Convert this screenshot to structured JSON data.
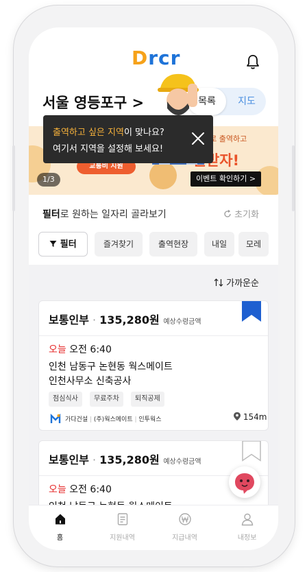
{
  "header": {
    "logo_text_d": "D",
    "logo_text_rest": "rcr",
    "location": "서울 영등포구 >",
    "view_toggle": {
      "list_label": "목록",
      "map_label": "지도"
    }
  },
  "banner": {
    "ticket_label": "교통비 지원",
    "sub_text": "으로 출역하고",
    "main_text": "~원받자!",
    "event_button": "이벤트 확인하기 >",
    "page_indicator": "1/3"
  },
  "tooltip": {
    "line1_highlight": "출역하고 싶은 지역",
    "line1_rest": "이 맞나요?",
    "line2": "여기서 지역을 설정해 보세요!"
  },
  "filter": {
    "title_bold": "필터",
    "title_rest": "로 원하는 일자리 골라보기",
    "reset_label": "초기화",
    "filter_button": "필터",
    "chips": [
      "즐겨찾기",
      "출역현장",
      "내일",
      "모레"
    ]
  },
  "sort": {
    "label": "가까운순"
  },
  "jobs": [
    {
      "type": "보통인부",
      "pay": "135,280원",
      "pay_label": "예상수령금액",
      "day": "오늘",
      "time": "오전 6:40",
      "place_line1": "인천 남동구 논현동 웍스메이트",
      "place_line2": "인천사무소 신축공사",
      "tags": [
        "점심식사",
        "무료주차",
        "퇴직공제"
      ],
      "companies": [
        "가다건설",
        "(주)웍스메이트",
        "인투웍스"
      ],
      "distance": "154m",
      "bookmarked": true
    },
    {
      "type": "보통인부",
      "pay": "135,280원",
      "pay_label": "예상수령금액",
      "day": "오늘",
      "time": "오전 6:40",
      "place_line1": "인천 남동구 논현동 웍스메이트",
      "bookmarked": false
    }
  ],
  "bottom_nav": [
    {
      "label": "홈",
      "icon": "home-icon",
      "active": true
    },
    {
      "label": "지원내역",
      "icon": "document-icon",
      "active": false
    },
    {
      "label": "지급내역",
      "icon": "won-icon",
      "active": false
    },
    {
      "label": "내정보",
      "icon": "user-icon",
      "active": false
    }
  ],
  "colors": {
    "accent_blue": "#1e73d8",
    "accent_orange": "#f6a21a",
    "today_red": "#e62b2b",
    "tooltip_highlight": "#f7b23b",
    "banner_orange": "#e9532a"
  }
}
